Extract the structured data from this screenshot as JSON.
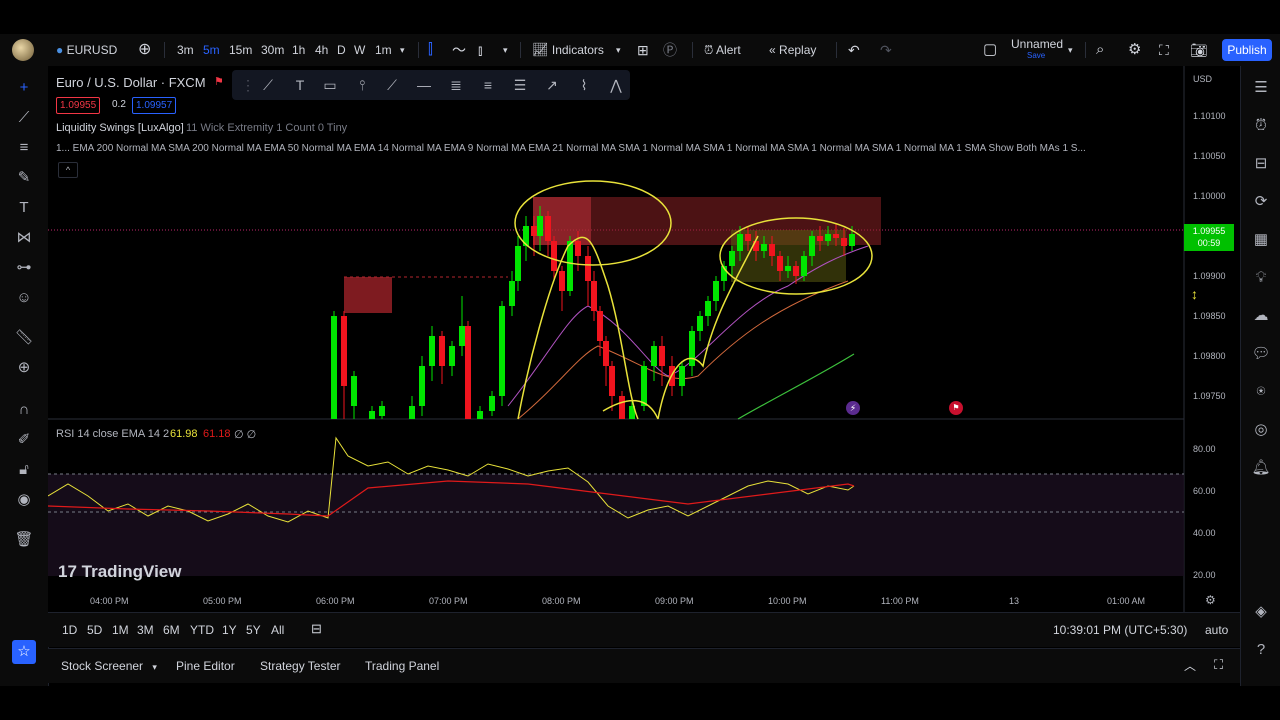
{
  "topbar": {
    "symbol": "EURUSD",
    "intervals": [
      "3m",
      "5m",
      "15m",
      "30m",
      "1h",
      "4h",
      "D",
      "W",
      "1m"
    ],
    "active_interval": "5m",
    "indicators_label": "Indicators",
    "alert_label": "Alert",
    "replay_label": "Replay",
    "layout_name": "Unnamed",
    "layout_saved": "Save",
    "publish_label": "Publish"
  },
  "legend": {
    "title": "Euro / U.S. Dollar · FXCM",
    "bid": "1.09955",
    "spread": "0.2",
    "ask": "1.09957",
    "ind1_name": "Liquidity Swings [LuxAlgo]",
    "ind1_params": "11 Wick Extremity 1 Count 0 Tiny",
    "ind2": "1... EMA 200 Normal MA SMA 200 Normal MA EMA 50 Normal MA EMA 14 Normal MA EMA 9 Normal MA EMA 21 Normal MA SMA 1 Normal MA SMA 1 Normal MA SMA 1 Normal MA SMA 1 Normal MA 1 SMA Show Both MAs 1 S...",
    "collapse": "^"
  },
  "price_axis": {
    "currency": "USD",
    "ticks": [
      "1.10100",
      "1.10050",
      "1.10000",
      "1.09900",
      "1.09850",
      "1.09800",
      "1.09750"
    ],
    "current_price": "1.09955",
    "countdown": "00:59"
  },
  "rsi": {
    "label": "RSI 14 close EMA 14 2",
    "value1": "61.98",
    "value2": "61.18",
    "extra": "∅ ∅",
    "ticks": [
      "80.00",
      "60.00",
      "40.00",
      "20.00"
    ]
  },
  "time_axis": {
    "labels": [
      "04:00 PM",
      "05:00 PM",
      "06:00 PM",
      "07:00 PM",
      "08:00 PM",
      "09:00 PM",
      "10:00 PM",
      "11:00 PM",
      "13",
      "01:00 AM"
    ]
  },
  "watermark": "TradingView",
  "range_bar": {
    "ranges": [
      "1D",
      "5D",
      "1M",
      "3M",
      "6M",
      "YTD",
      "1Y",
      "5Y",
      "All"
    ],
    "clock": "10:39:01 PM (UTC+5:30)",
    "auto": "auto"
  },
  "bottom_panel": {
    "tabs": [
      "Stock Screener",
      "Pine Editor",
      "Strategy Tester",
      "Trading Panel"
    ]
  },
  "colors": {
    "bull": "#00e600",
    "bear": "#f0141e",
    "accent": "#2962ff",
    "annotation": "#e8e23a"
  },
  "icons": {
    "left": [
      "crosshair-icon",
      "trendline-icon",
      "fib-icon",
      "brush-icon",
      "text-icon",
      "pattern-icon",
      "forecast-icon",
      "emoji-icon",
      "ruler-icon",
      "zoom-icon",
      "magnet-icon",
      "lock-drawings-icon",
      "lock-icon",
      "eye-icon",
      "trash-icon"
    ],
    "right": [
      "watchlist-icon",
      "alerts-icon",
      "data-window-icon",
      "hotlist-icon",
      "calendar-icon",
      "ideas-icon",
      "streams-icon",
      "chat-icon",
      "signals-icon",
      "broadcast-icon",
      "notifications-icon"
    ]
  }
}
